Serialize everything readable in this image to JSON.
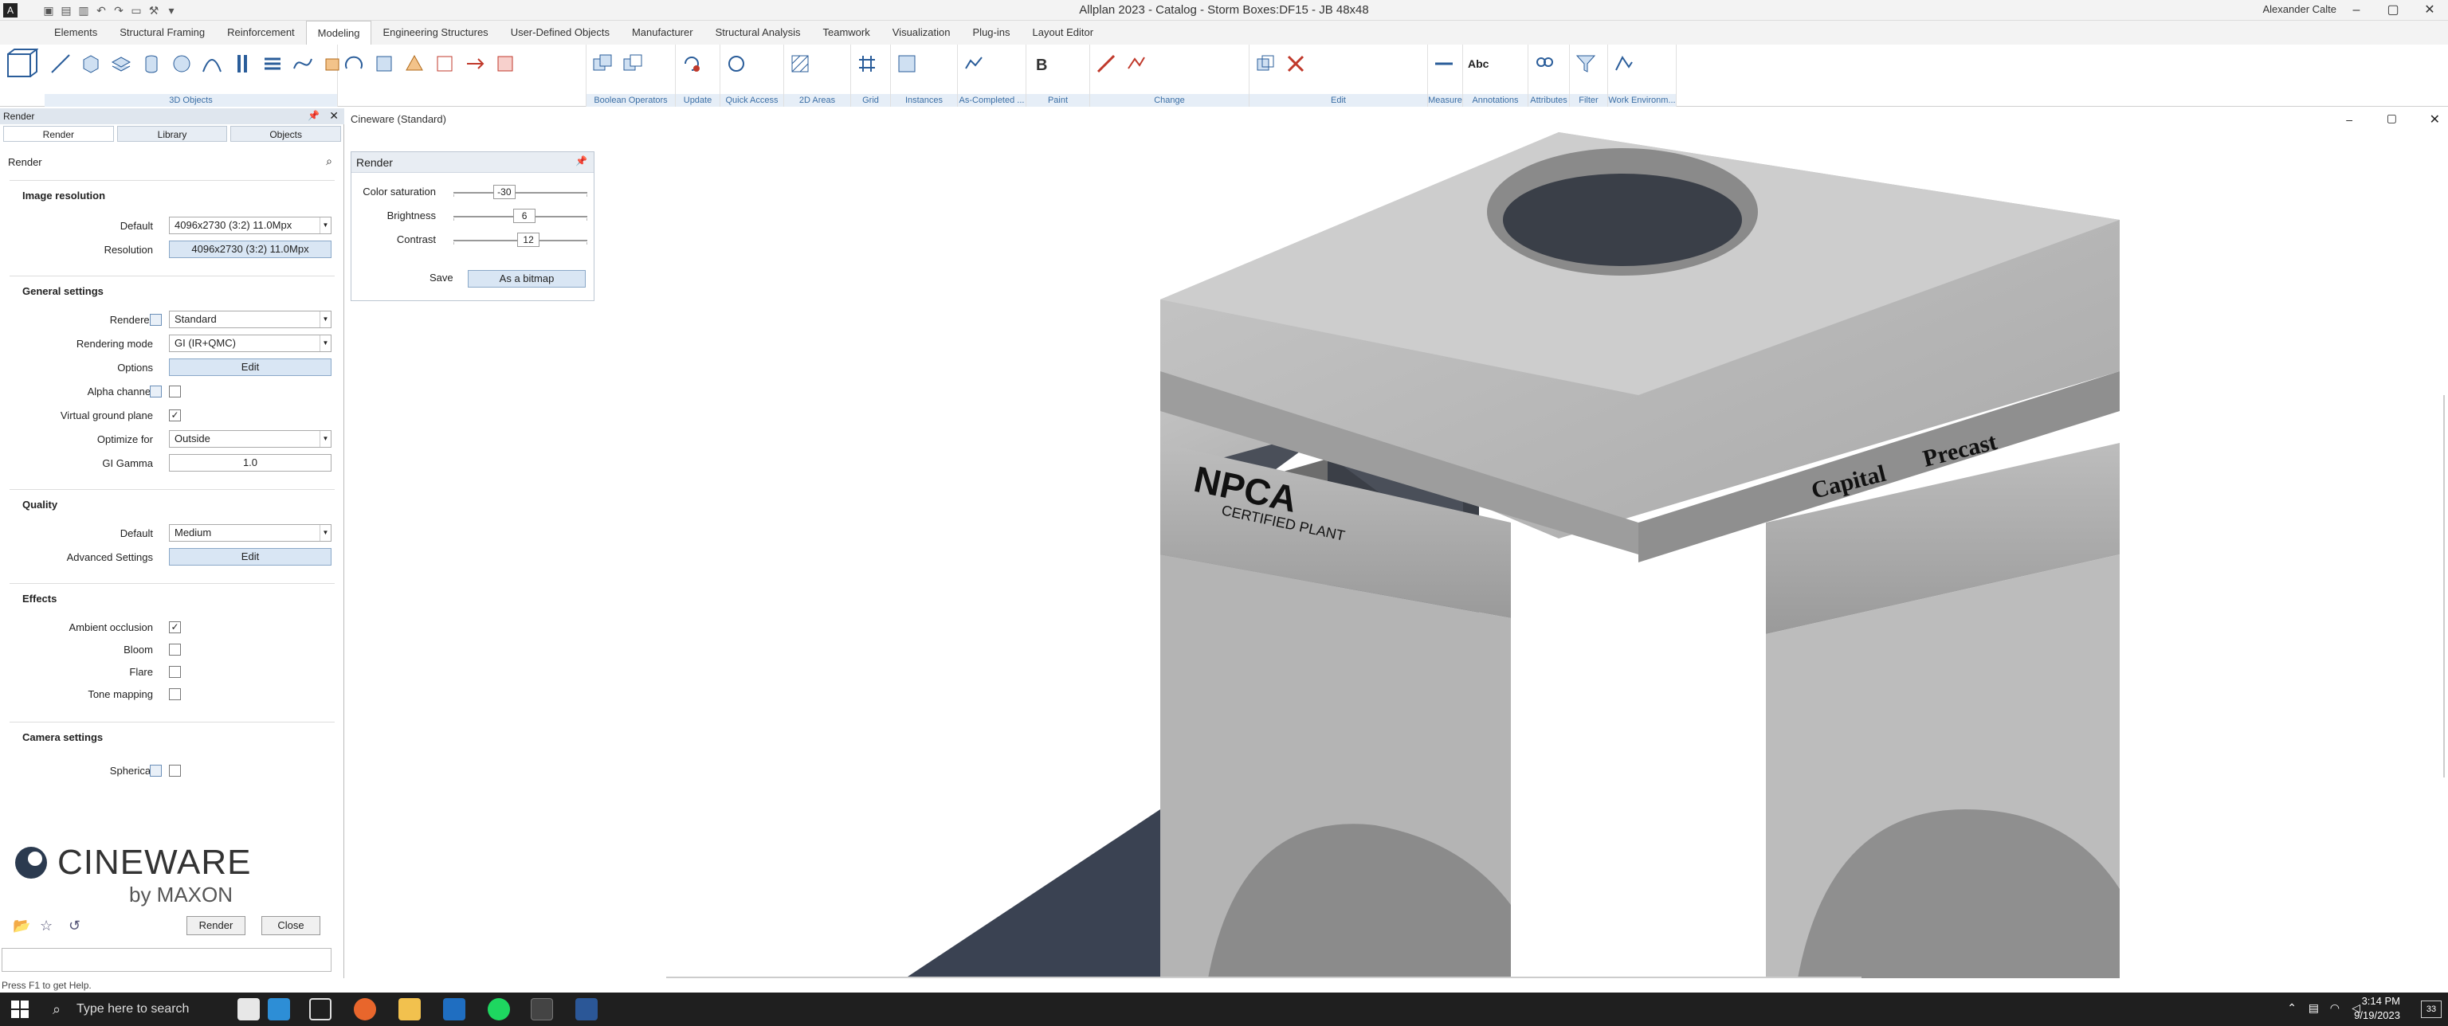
{
  "titlebar": {
    "app_title": "Allplan 2023 - Catalog - Storm Boxes:DF15 - JB 48x48",
    "user": "Alexander Calte"
  },
  "menu": {
    "tabs": [
      "Elements",
      "Structural Framing",
      "Reinforcement",
      "Modeling",
      "Engineering Structures",
      "User-Defined Objects",
      "Manufacturer",
      "Structural Analysis",
      "Teamwork",
      "Visualization",
      "Plug-ins",
      "Layout Editor"
    ],
    "active": "Modeling"
  },
  "ribbon": {
    "groups": [
      "3D Objects",
      "Boolean Operators",
      "Update",
      "Quick Access",
      "2D Areas",
      "Grid",
      "Instances",
      "As-Completed ...",
      "Paint",
      "Change",
      "Edit",
      "Measure",
      "Annotations",
      "Attributes",
      "Filter",
      "Work Environm..."
    ],
    "annotations_label": "Abc"
  },
  "panel": {
    "title": "Render",
    "tabs": [
      "Render",
      "Library",
      "Objects"
    ],
    "search_label": "Render",
    "sections": {
      "image": "Image resolution",
      "general": "General settings",
      "quality": "Quality",
      "effects": "Effects",
      "camera": "Camera settings"
    },
    "labels": {
      "default": "Default",
      "resolution": "Resolution",
      "renderer": "Renderer",
      "rendering_mode": "Rendering mode",
      "options": "Options",
      "alpha": "Alpha channel",
      "ground": "Virtual ground plane",
      "optimize": "Optimize for",
      "gamma": "GI Gamma",
      "quality_default": "Default",
      "advanced": "Advanced Settings",
      "ao": "Ambient occlusion",
      "bloom": "Bloom",
      "flare": "Flare",
      "tone": "Tone mapping",
      "spherical": "Spherical"
    },
    "values": {
      "default_res": "4096x2730 (3:2) 11.0Mpx",
      "resolution_btn": "4096x2730 (3:2) 11.0Mpx",
      "renderer": "Standard",
      "rendering_mode": "GI (IR+QMC)",
      "options_btn": "Edit",
      "optimize": "Outside",
      "gamma": "1.0",
      "quality": "Medium",
      "advanced_btn": "Edit"
    },
    "checks": {
      "alpha": false,
      "ground": true,
      "ao": true,
      "bloom": false,
      "flare": false,
      "tone": false,
      "spherical": false
    },
    "logo_line1": "CINEWARE",
    "logo_line2": "by MAXON",
    "render_btn": "Render",
    "close_btn": "Close"
  },
  "status": "Press F1 to get Help.",
  "viewport": {
    "title": "Cineware (Standard)",
    "render_box": {
      "title": "Render",
      "sliders": [
        {
          "label": "Color saturation",
          "value": "-30",
          "level": 0.38
        },
        {
          "label": "Brightness",
          "value": "6",
          "level": 0.53
        },
        {
          "label": "Contrast",
          "value": "12",
          "level": 0.56
        }
      ],
      "save_label": "Save",
      "save_btn": "As a bitmap"
    },
    "logo_left": "NPCA",
    "logo_left_sub": "CERTIFIED PLANT",
    "logo_right_1": "Capital",
    "logo_right_2": "Precast"
  },
  "taskbar": {
    "search": "Type here to search",
    "time": "3:14 PM",
    "date": "9/19/2023",
    "badge": "33"
  }
}
